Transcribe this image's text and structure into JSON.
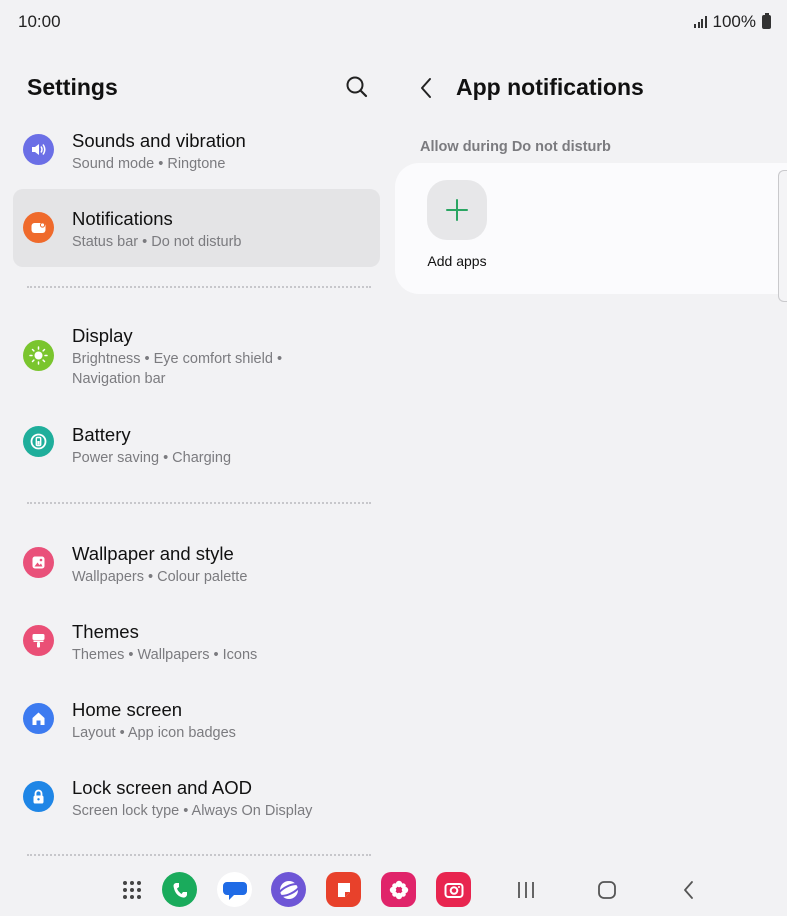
{
  "status": {
    "time": "10:00",
    "battery": "100%"
  },
  "left": {
    "title": "Settings",
    "items": [
      {
        "title": "Sounds and vibration",
        "subtitle": "Sound mode  •  Ringtone",
        "icon": "speaker-icon",
        "color": "#6b6fe6"
      },
      {
        "title": "Notifications",
        "subtitle": "Status bar  •  Do not disturb",
        "icon": "notification-icon",
        "color": "#ef6a2c"
      },
      {
        "title": "Display",
        "subtitle": "Brightness  •  Eye comfort shield  •",
        "subtitle2": "Navigation bar",
        "icon": "sun-icon",
        "color": "#7ac52e"
      },
      {
        "title": "Battery",
        "subtitle": "Power saving  •  Charging",
        "icon": "battery-icon",
        "color": "#1fae9b"
      },
      {
        "title": "Wallpaper and style",
        "subtitle": "Wallpapers  •  Colour palette",
        "icon": "wallpaper-icon",
        "color": "#e9517a"
      },
      {
        "title": "Themes",
        "subtitle": "Themes  •  Wallpapers  •  Icons",
        "icon": "brush-icon",
        "color": "#ea4f76"
      },
      {
        "title": "Home screen",
        "subtitle": "Layout  •  App icon badges",
        "icon": "home-icon",
        "color": "#3d7bf0"
      },
      {
        "title": "Lock screen and AOD",
        "subtitle": "Screen lock type  •  Always On Display",
        "icon": "lock-icon",
        "color": "#1f86e6"
      }
    ]
  },
  "right": {
    "title": "App notifications",
    "section_label": "Allow during Do not disturb",
    "add_apps_label": "Add apps"
  },
  "dock": {
    "apps": [
      "apps-grid-icon",
      "phone-icon",
      "messages-icon",
      "internet-icon",
      "notes-icon",
      "gallery-icon",
      "camera-icon"
    ]
  }
}
